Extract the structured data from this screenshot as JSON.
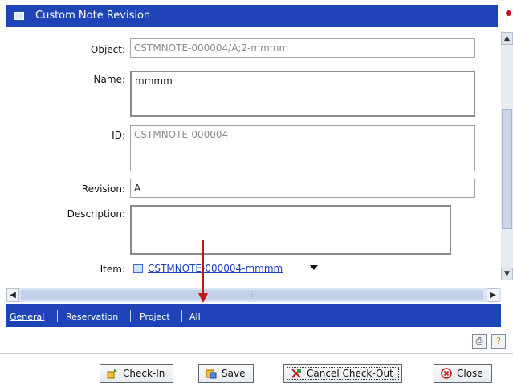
{
  "window": {
    "title": "Custom Note Revision"
  },
  "form": {
    "object_label": "Object:",
    "object_value": "CSTMNOTE-000004/A;2-mmmm",
    "name_label": "Name:",
    "name_value": "mmmm",
    "id_label": "ID:",
    "id_value": "CSTMNOTE-000004",
    "revision_label": "Revision:",
    "revision_value": "A",
    "description_label": "Description:",
    "description_value": "",
    "item_label": "Item:",
    "item_value": "CSTMNOTE-000004-mmmm"
  },
  "tabs": [
    {
      "label": "General",
      "active": true
    },
    {
      "label": "Reservation",
      "active": false
    },
    {
      "label": "Project",
      "active": false
    },
    {
      "label": "All",
      "active": false
    }
  ],
  "buttons": {
    "checkin": "Check-In",
    "save": "Save",
    "cancel_checkout": "Cancel Check-Out",
    "close": "Close"
  },
  "icons": [
    "window-icon",
    "pin-icon",
    "item-icon",
    "dropdown-icon",
    "checkin-icon",
    "save-icon",
    "cancel-checkout-icon",
    "close-icon",
    "print-icon",
    "help-icon"
  ],
  "colors": {
    "accent": "#1f44b8",
    "link": "#1a3fbf",
    "annotation_arrow": "#c31414"
  }
}
